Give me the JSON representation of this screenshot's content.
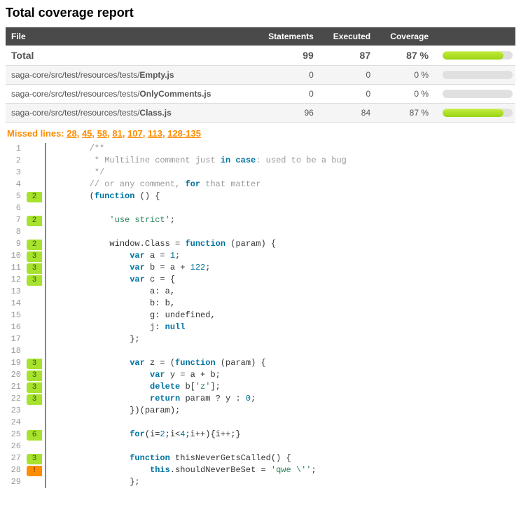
{
  "title": "Total coverage report",
  "table": {
    "headers": {
      "file": "File",
      "statements": "Statements",
      "executed": "Executed",
      "coverage": "Coverage"
    },
    "rows": [
      {
        "label_prefix": "",
        "label_bold": "Total",
        "statements": "99",
        "executed": "87",
        "coverage": "87 %",
        "pct": 87,
        "total": true
      },
      {
        "label_prefix": "saga-core/src/test/resources/tests/",
        "label_bold": "Empty.js",
        "statements": "0",
        "executed": "0",
        "coverage": "0 %",
        "pct": 0
      },
      {
        "label_prefix": "saga-core/src/test/resources/tests/",
        "label_bold": "OnlyComments.js",
        "statements": "0",
        "executed": "0",
        "coverage": "0 %",
        "pct": 0
      },
      {
        "label_prefix": "saga-core/src/test/resources/tests/",
        "label_bold": "Class.js",
        "statements": "96",
        "executed": "84",
        "coverage": "87 %",
        "pct": 87
      }
    ]
  },
  "missed": {
    "prefix": "Missed lines: ",
    "links": [
      "28",
      "45",
      "58",
      "81",
      "107",
      "113",
      "128-135"
    ]
  },
  "code": {
    "lines": [
      {
        "n": 1,
        "hit": null,
        "type": null,
        "html": "        <span class='cm-comment'>/**</span>"
      },
      {
        "n": 2,
        "hit": null,
        "type": null,
        "html": "        <span class='cm-comment'> * Multiline comment just </span><span class='cm-keyword'>in case</span><span class='cm-comment'>: used to be a bug</span>"
      },
      {
        "n": 3,
        "hit": null,
        "type": null,
        "html": "        <span class='cm-comment'> */</span>"
      },
      {
        "n": 4,
        "hit": null,
        "type": null,
        "html": "        <span class='cm-comment'>// or any comment, </span><span class='cm-keyword'>for</span><span class='cm-comment'> that matter</span>"
      },
      {
        "n": 5,
        "hit": "2",
        "type": "green",
        "html": "        (<span class='cm-keyword'>function</span> () {"
      },
      {
        "n": 6,
        "hit": null,
        "type": null,
        "html": ""
      },
      {
        "n": 7,
        "hit": "2",
        "type": "green",
        "html": "            <span class='cm-string'>'use strict'</span>;"
      },
      {
        "n": 8,
        "hit": null,
        "type": null,
        "html": ""
      },
      {
        "n": 9,
        "hit": "2",
        "type": "green",
        "html": "            window.Class = <span class='cm-keyword'>function</span> (param) {"
      },
      {
        "n": 10,
        "hit": "3",
        "type": "green",
        "html": "                <span class='cm-keyword'>var</span> a = <span class='cm-number'>1</span>;"
      },
      {
        "n": 11,
        "hit": "3",
        "type": "green",
        "html": "                <span class='cm-keyword'>var</span> b = a + <span class='cm-number'>122</span>;"
      },
      {
        "n": 12,
        "hit": "3",
        "type": "green",
        "html": "                <span class='cm-keyword'>var</span> c = {"
      },
      {
        "n": 13,
        "hit": null,
        "type": null,
        "html": "                    a: a,"
      },
      {
        "n": 14,
        "hit": null,
        "type": null,
        "html": "                    b: b,"
      },
      {
        "n": 15,
        "hit": null,
        "type": null,
        "html": "                    g: undefined,"
      },
      {
        "n": 16,
        "hit": null,
        "type": null,
        "html": "                    j: <span class='cm-null'>null</span>"
      },
      {
        "n": 17,
        "hit": null,
        "type": null,
        "html": "                };"
      },
      {
        "n": 18,
        "hit": null,
        "type": null,
        "html": ""
      },
      {
        "n": 19,
        "hit": "3",
        "type": "green",
        "html": "                <span class='cm-keyword'>var</span> z = (<span class='cm-keyword'>function</span> (param) {"
      },
      {
        "n": 20,
        "hit": "3",
        "type": "green",
        "html": "                    <span class='cm-keyword'>var</span> y = a + b;"
      },
      {
        "n": 21,
        "hit": "3",
        "type": "green",
        "html": "                    <span class='cm-keyword'>delete</span> b[<span class='cm-string'>'z'</span>];"
      },
      {
        "n": 22,
        "hit": "3",
        "type": "green",
        "html": "                    <span class='cm-keyword'>return</span> param ? y : <span class='cm-number'>0</span>;"
      },
      {
        "n": 23,
        "hit": null,
        "type": null,
        "html": "                })(param);"
      },
      {
        "n": 24,
        "hit": null,
        "type": null,
        "html": ""
      },
      {
        "n": 25,
        "hit": "6",
        "type": "green",
        "html": "                <span class='cm-keyword'>for</span>(i=<span class='cm-number'>2</span>;i&lt;<span class='cm-number'>4</span>;i++){i++;}"
      },
      {
        "n": 26,
        "hit": null,
        "type": null,
        "html": ""
      },
      {
        "n": 27,
        "hit": "3",
        "type": "green",
        "html": "                <span class='cm-keyword'>function</span> thisNeverGetsCalled() {"
      },
      {
        "n": 28,
        "hit": "!",
        "type": "orange",
        "html": "                    <span class='cm-keyword'>this</span>.shouldNeverBeSet = <span class='cm-string'>'qwe \\''</span>;"
      },
      {
        "n": 29,
        "hit": null,
        "type": null,
        "html": "                };"
      }
    ]
  }
}
